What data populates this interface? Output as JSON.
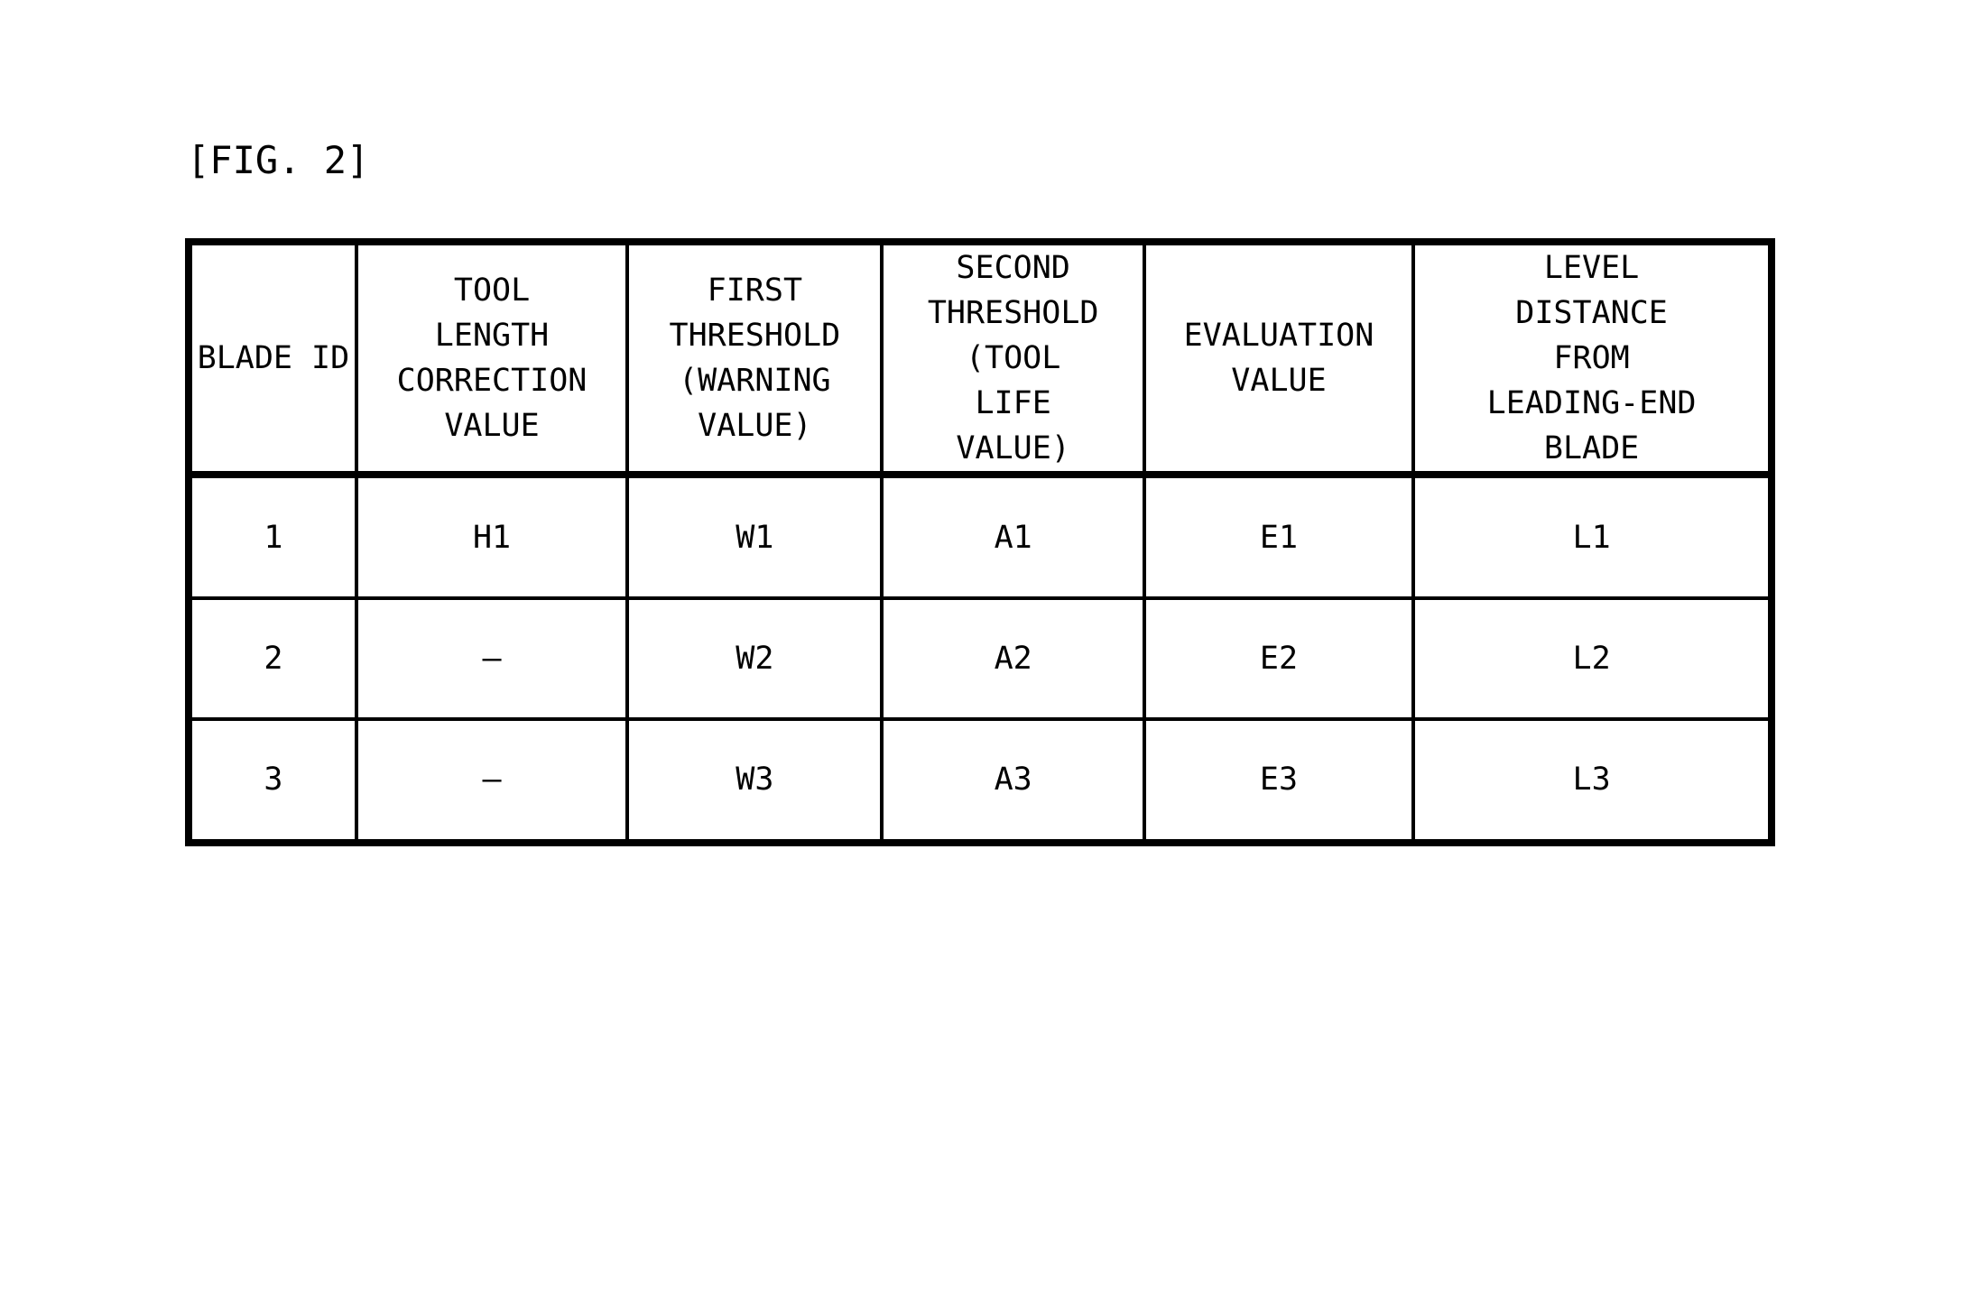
{
  "figure": {
    "label": "[FIG. 2]"
  },
  "table": {
    "columns": [
      {
        "id": "blade-id",
        "header": "BLADE ID"
      },
      {
        "id": "tool-length-correction",
        "header": "TOOL\nLENGTH\nCORRECTION\nVALUE"
      },
      {
        "id": "first-threshold",
        "header": "FIRST\nTHRESHOLD\n(WARNING\nVALUE)"
      },
      {
        "id": "second-threshold",
        "header": "SECOND\nTHRESHOLD\n(TOOL\nLIFE\nVALUE)"
      },
      {
        "id": "evaluation-value",
        "header": "EVALUATION\nVALUE"
      },
      {
        "id": "level-distance",
        "header": "LEVEL\nDISTANCE\nFROM\nLEADING-END\nBLADE"
      }
    ],
    "rows": [
      {
        "blade_id": "1",
        "tool_length_correction": "H1",
        "first_threshold": "W1",
        "second_threshold": "A1",
        "evaluation_value": "E1",
        "level_distance": "L1"
      },
      {
        "blade_id": "2",
        "tool_length_correction": "—",
        "first_threshold": "W2",
        "second_threshold": "A2",
        "evaluation_value": "E2",
        "level_distance": "L2"
      },
      {
        "blade_id": "3",
        "tool_length_correction": "—",
        "first_threshold": "W3",
        "second_threshold": "A3",
        "evaluation_value": "E3",
        "level_distance": "L3"
      }
    ]
  },
  "colors": {
    "ink": "#000000",
    "paper": "#ffffff"
  }
}
